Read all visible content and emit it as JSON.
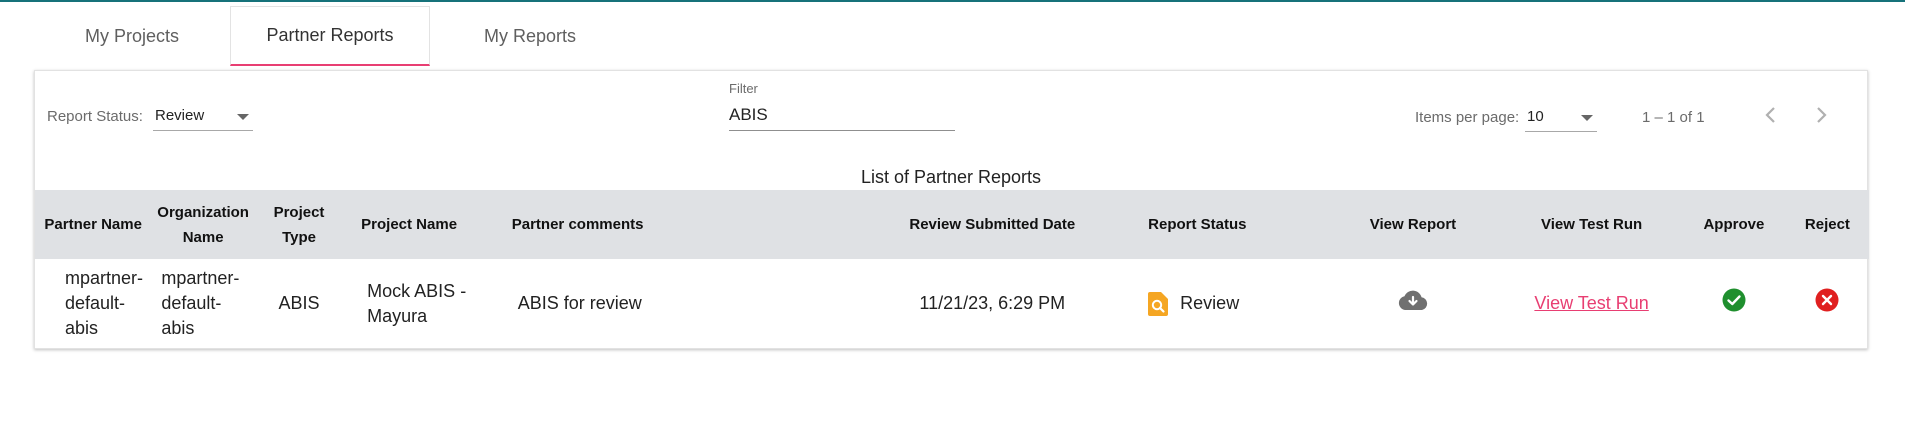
{
  "tabs": [
    {
      "label": "My Projects"
    },
    {
      "label": "Partner Reports"
    },
    {
      "label": "My Reports"
    }
  ],
  "toolbar": {
    "report_status_label": "Report Status:",
    "report_status_value": "Review",
    "filter_label": "Filter",
    "filter_value": "ABIS",
    "items_per_page_label": "Items per page:",
    "items_per_page_value": "10",
    "range_label": "1 – 1 of 1"
  },
  "list_title": "List of Partner Reports",
  "table": {
    "headers": {
      "partner_name": "Partner Name",
      "organization_name": "Organization Name",
      "project_type": "Project Type",
      "project_name": "Project Name",
      "partner_comments": "Partner comments",
      "review_submitted_date": "Review Submitted Date",
      "report_status": "Report Status",
      "view_report": "View Report",
      "view_test_run": "View Test Run",
      "approve": "Approve",
      "reject": "Reject"
    },
    "rows": [
      {
        "partner_name": "mpartner-default-abis",
        "organization_name": "mpartner-default-abis",
        "project_type": "ABIS",
        "project_name": "Mock ABIS - Mayura",
        "partner_comments": "ABIS for review",
        "review_submitted_date": "11/21/23, 6:29 PM",
        "report_status": "Review",
        "view_test_run": "View Test Run"
      }
    ]
  },
  "colors": {
    "accent": "#e83e72",
    "top_line": "#16727a",
    "header_bg": "#dfe1e4",
    "approve": "#1f8f2e",
    "reject": "#e02020",
    "review_icon": "#f5a623"
  },
  "icons": {
    "status_caret": "chevron-down-icon",
    "prev_page": "chevron-left-icon",
    "next_page": "chevron-right-icon",
    "review_status": "document-search-icon",
    "view_report": "cloud-download-icon",
    "approve": "check-circle-icon",
    "reject": "close-circle-icon"
  }
}
